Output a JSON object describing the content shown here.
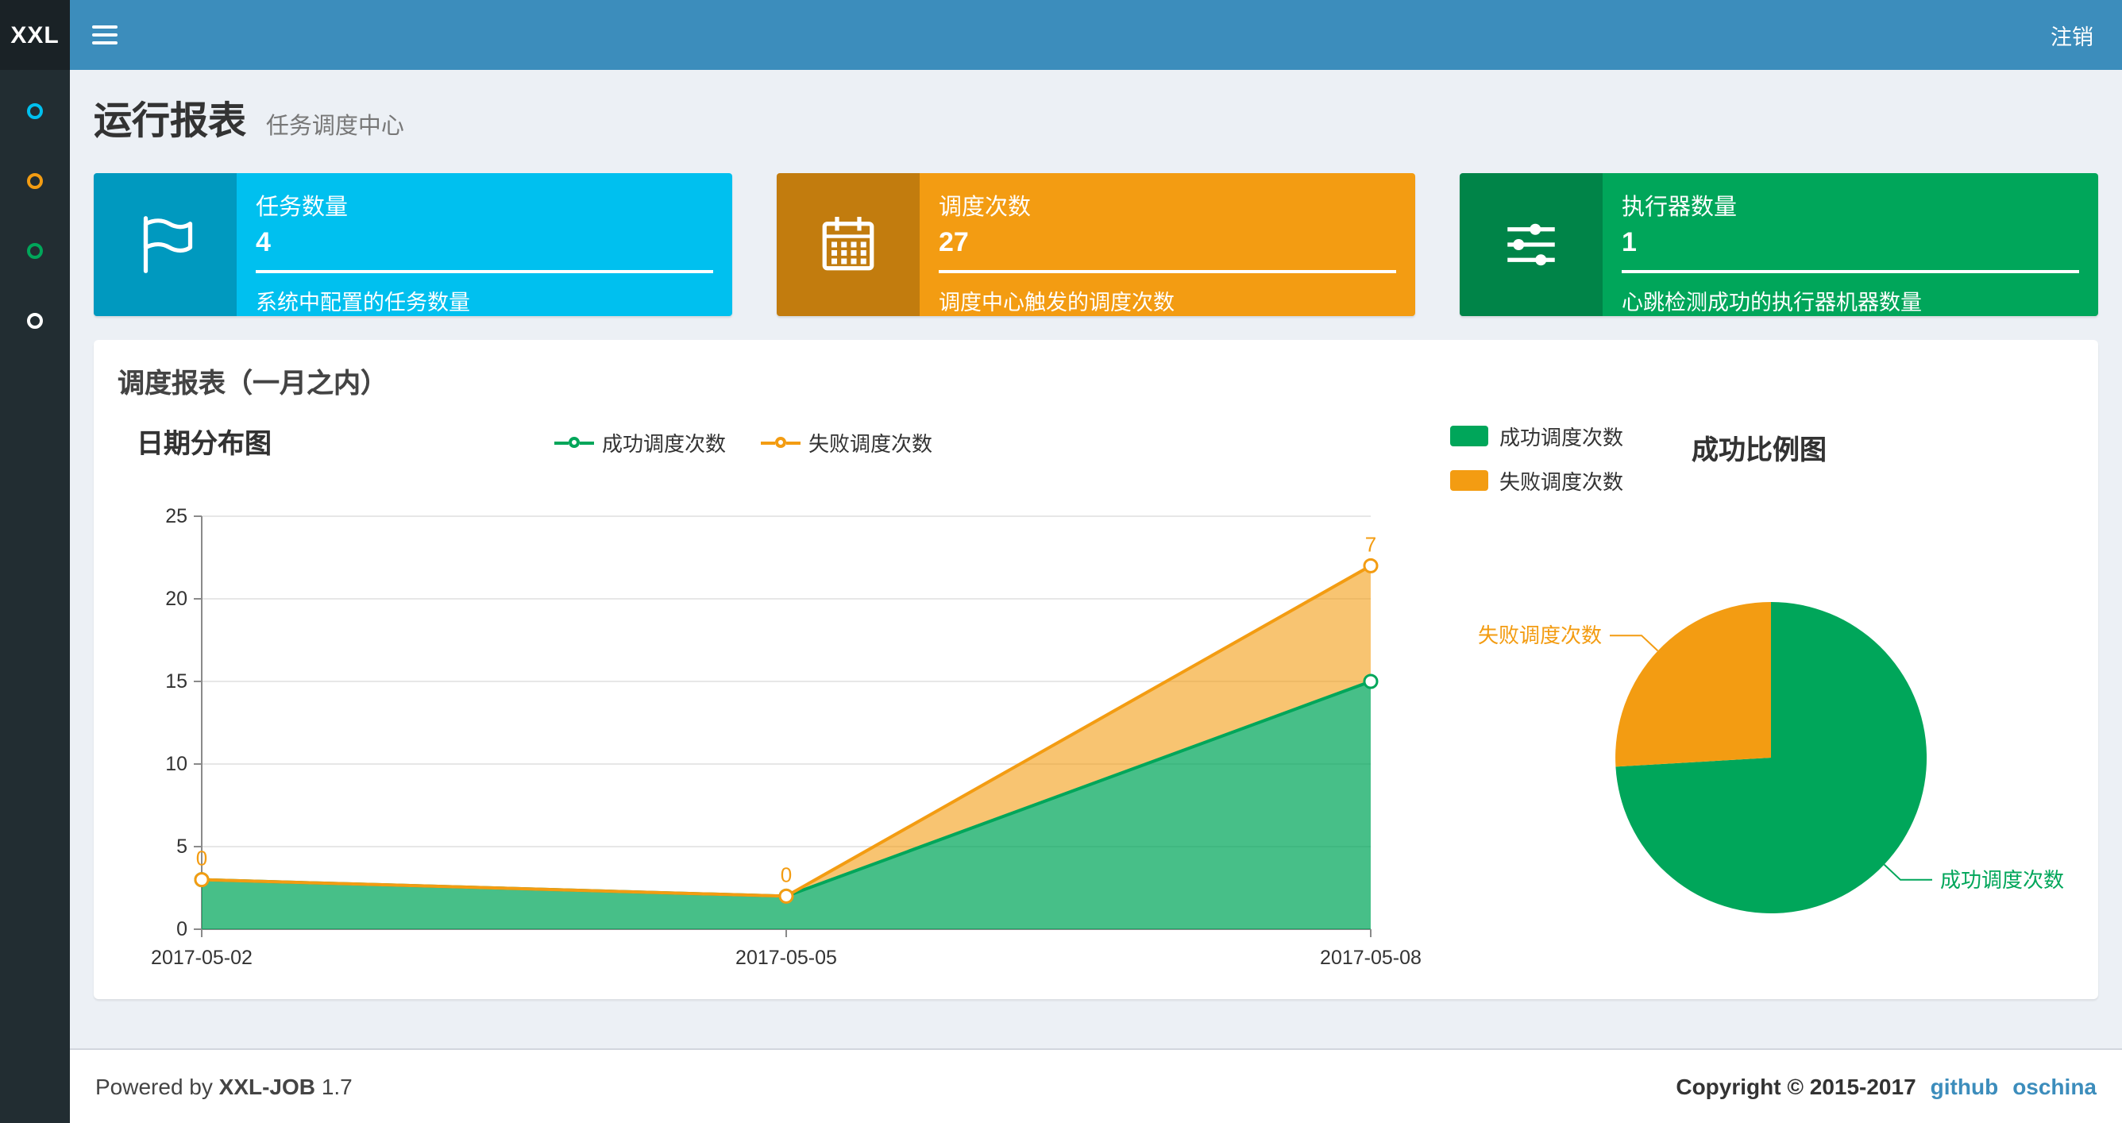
{
  "navbar": {
    "logo": "XXL",
    "logout": "注销"
  },
  "sidebar": {
    "items": [
      {
        "icon": "circle-aqua-icon",
        "color": "#00c0ef"
      },
      {
        "icon": "circle-yellow-icon",
        "color": "#f39c12"
      },
      {
        "icon": "circle-green-icon",
        "color": "#00a65a"
      },
      {
        "icon": "circle-white-icon",
        "color": "#ffffff"
      }
    ]
  },
  "page": {
    "title": "运行报表",
    "subtitle": "任务调度中心"
  },
  "info_boxes": [
    {
      "icon": "flag-icon",
      "label": "任务数量",
      "value": "4",
      "description": "系统中配置的任务数量",
      "color": "#00c0ef"
    },
    {
      "icon": "calendar-icon",
      "label": "调度次数",
      "value": "27",
      "description": "调度中心触发的调度次数",
      "color": "#f39c12"
    },
    {
      "icon": "sliders-icon",
      "label": "执行器数量",
      "value": "1",
      "description": "心跳检测成功的执行器机器数量",
      "color": "#00a65a"
    }
  ],
  "panel": {
    "title": "调度报表（一月之内）"
  },
  "chart_data": [
    {
      "type": "area",
      "title": "日期分布图",
      "stacked": true,
      "x": [
        "2017-05-02",
        "2017-05-05",
        "2017-05-08"
      ],
      "series": [
        {
          "name": "成功调度次数",
          "values": [
            3,
            2,
            15
          ],
          "color": "#00a65a"
        },
        {
          "name": "失败调度次数",
          "values": [
            0,
            0,
            7
          ],
          "color": "#f39c12"
        }
      ],
      "ylim": [
        0,
        25
      ],
      "yticks": [
        0,
        5,
        10,
        15,
        20,
        25
      ],
      "grid": true,
      "legend_position": "top-center"
    },
    {
      "type": "pie",
      "title": "成功比例图",
      "slices": [
        {
          "name": "成功调度次数",
          "value": 20,
          "color": "#00a65a"
        },
        {
          "name": "失败调度次数",
          "value": 7,
          "color": "#f39c12"
        }
      ],
      "legend_position": "top-left"
    }
  ],
  "footer": {
    "powered_by": "Powered by",
    "brand": "XXL-JOB",
    "version": "1.7",
    "copyright": "Copyright © 2015-2017",
    "links": [
      "github",
      "oschina"
    ]
  }
}
